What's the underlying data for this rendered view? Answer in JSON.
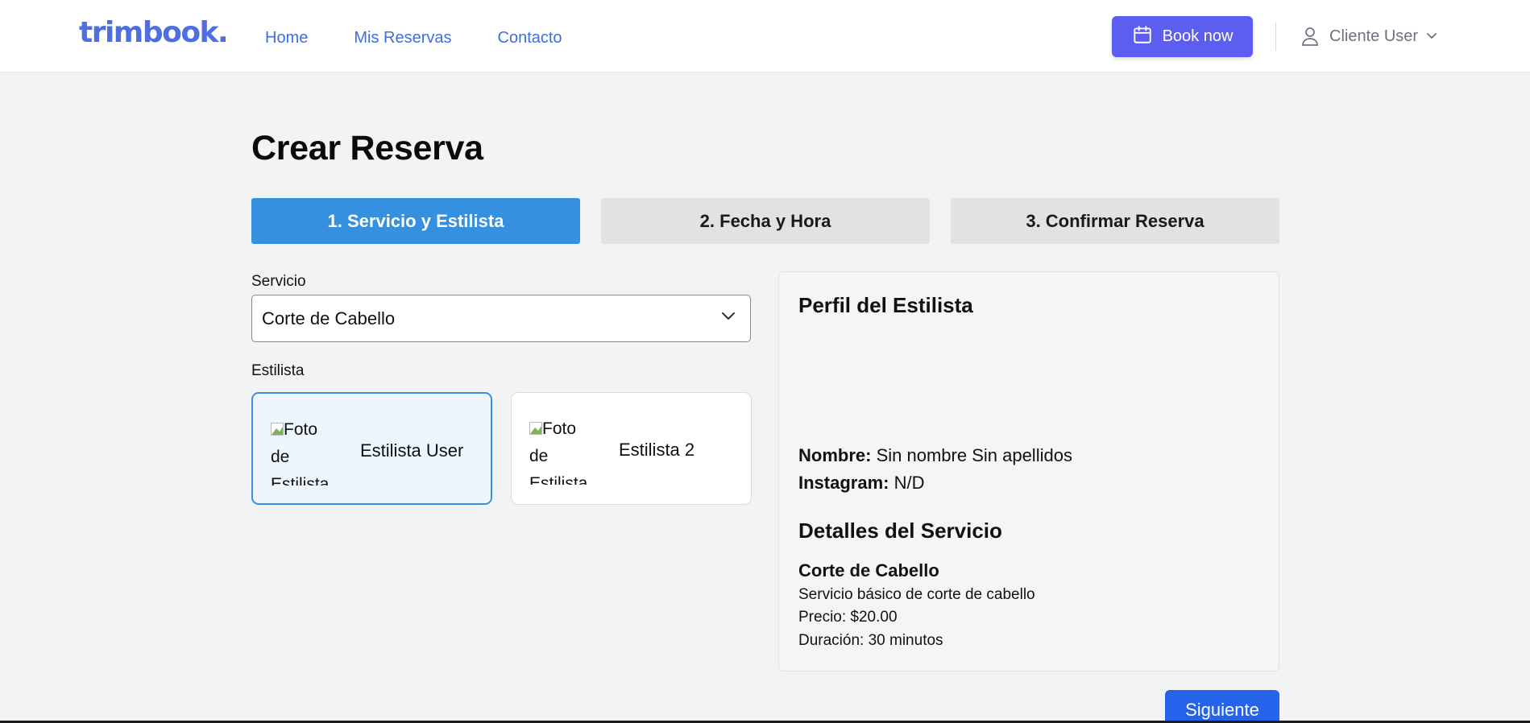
{
  "header": {
    "logo": "trimbook.",
    "nav": [
      "Home",
      "Mis Reservas",
      "Contacto"
    ],
    "book_label": "Book now",
    "user_label": "Cliente User"
  },
  "page": {
    "title": "Crear Reserva"
  },
  "steps": [
    {
      "label": "1. Servicio y Estilista",
      "active": true
    },
    {
      "label": "2. Fecha y Hora",
      "active": false
    },
    {
      "label": "3. Confirmar Reserva",
      "active": false
    }
  ],
  "form": {
    "service_label": "Servicio",
    "service_value": "Corte de Cabello",
    "stylist_label": "Estilista",
    "stylists": [
      {
        "photo_alt": "Foto de Estilista",
        "name": "Estilista User",
        "selected": true
      },
      {
        "photo_alt": "Foto de Estilista",
        "name": "Estilista 2",
        "selected": false
      }
    ]
  },
  "profile": {
    "title": "Perfil del Estilista",
    "name_label": "Nombre:",
    "name_value": "Sin nombre Sin apellidos",
    "instagram_label": "Instagram:",
    "instagram_value": "N/D",
    "details_title": "Detalles del Servicio",
    "service_name": "Corte de Cabello",
    "service_description": "Servicio básico de corte de cabello",
    "price": "Precio: $20.00",
    "duration": "Duración: 30 minutos"
  },
  "actions": {
    "next_label": "Siguiente"
  },
  "colors": {
    "brand": "#4f6fe0",
    "book_button": "#5b5ef0",
    "active_step": "#3590df",
    "next_button": "#2563eb"
  }
}
